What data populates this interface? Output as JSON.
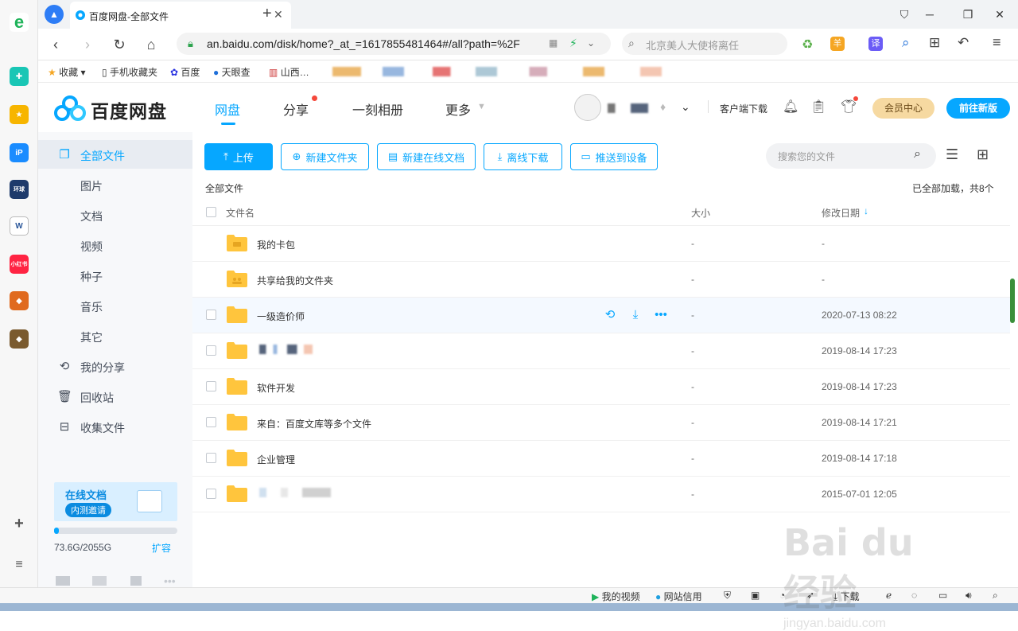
{
  "browser": {
    "tab_title": "百度网盘-全部文件",
    "url": "an.baidu.com/disk/home?_at_=1617855481464#/all?path=%2F",
    "search_placeholder": "北京美人大使将离任",
    "translate_label": "译"
  },
  "bookmarks": {
    "items": [
      "收藏",
      "手机收藏夹",
      "百度",
      "天眼查",
      "山西…"
    ]
  },
  "pan": {
    "logo": "百度网盘",
    "nav": [
      "网盘",
      "分享",
      "一刻相册",
      "更多"
    ],
    "client_download": "客户端下载",
    "vip_center": "会员中心",
    "new_version": "前往新版"
  },
  "sidebar": {
    "items": [
      {
        "label": "全部文件",
        "icon": "files-icon"
      },
      {
        "label": "图片"
      },
      {
        "label": "文档"
      },
      {
        "label": "视频"
      },
      {
        "label": "种子"
      },
      {
        "label": "音乐"
      },
      {
        "label": "其它"
      },
      {
        "label": "我的分享",
        "icon": "share-icon"
      },
      {
        "label": "回收站",
        "icon": "trash-icon"
      },
      {
        "label": "收集文件",
        "icon": "collect-icon"
      }
    ],
    "promo_title": "在线文档",
    "promo_sub": "内测邀请",
    "quota": "73.6G/2055G",
    "quota_fraction": 0.036,
    "expand": "扩容"
  },
  "toolbar": {
    "upload": "上传",
    "new_folder": "新建文件夹",
    "new_doc": "新建在线文档",
    "offline_download": "离线下载",
    "push_device": "推送到设备",
    "search_placeholder": "搜索您的文件"
  },
  "list": {
    "breadcrumb": "全部文件",
    "loaded_status": "已全部加载，共8个",
    "col_name": "文件名",
    "col_size": "大小",
    "col_date": "修改日期",
    "rows": [
      {
        "name": "我的卡包",
        "size": "-",
        "date": "-"
      },
      {
        "name": "共享给我的文件夹",
        "size": "-",
        "date": "-"
      },
      {
        "name": "一级造价师",
        "size": "-",
        "date": "2020-07-13 08:22"
      },
      {
        "name": "",
        "size": "-",
        "date": "2019-08-14 17:23"
      },
      {
        "name": "软件开发",
        "size": "-",
        "date": "2019-08-14 17:23"
      },
      {
        "name": "来自：百度文库等多个文件",
        "size": "-",
        "date": "2019-08-14 17:21"
      },
      {
        "name": "企业管理",
        "size": "-",
        "date": "2019-08-14 17:18"
      },
      {
        "name": "",
        "size": "-",
        "date": "2015-07-01 12:05"
      }
    ]
  },
  "statusbar": {
    "my_video": "我的视频",
    "site_credit": "网站信用",
    "download": "下载"
  },
  "colors": {
    "accent": "#06a7ff",
    "folder": "#ffc53d"
  }
}
